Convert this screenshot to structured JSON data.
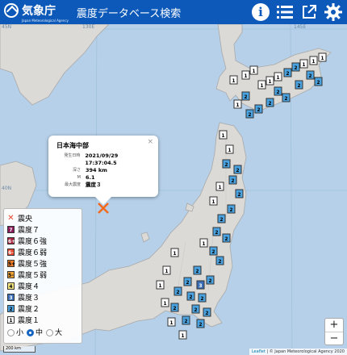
{
  "header": {
    "logo_text": "気象庁",
    "logo_sub": "Japan Meteorological Agency",
    "title": "震度データベース検索"
  },
  "map_labels": {
    "lat_top": "45N",
    "lat_mid": "40N",
    "lon_left": "130E",
    "lon_right": "145E"
  },
  "popup": {
    "title": "日本海中部",
    "close": "×",
    "rows": [
      {
        "label": "発生日時",
        "value": "2021/09/29 17:37:04.5"
      },
      {
        "label": "深さ",
        "value": "394 km"
      },
      {
        "label": "M",
        "value": "6.1"
      },
      {
        "label": "最大震度",
        "value": "震度３"
      }
    ]
  },
  "legend": {
    "epicenter": "震央",
    "items": [
      {
        "num": "7",
        "label": "震度７",
        "color": "#8b1a5a"
      },
      {
        "num": "6+",
        "label": "震度６強",
        "color": "#a3213b"
      },
      {
        "num": "6-",
        "label": "震度６弱",
        "color": "#e5452b"
      },
      {
        "num": "5+",
        "label": "震度５強",
        "color": "#f07d2a"
      },
      {
        "num": "5-",
        "label": "震度５弱",
        "color": "#f7a534"
      },
      {
        "num": "4",
        "label": "震度４",
        "color": "#f6e87e"
      },
      {
        "num": "3",
        "label": "震度３",
        "color": "#3a6fb8"
      },
      {
        "num": "2",
        "label": "震度２",
        "color": "#4aa3e0"
      },
      {
        "num": "1",
        "label": "震度１",
        "color": "#ffffff"
      }
    ],
    "sizes": [
      {
        "label": "小",
        "selected": false
      },
      {
        "label": "中",
        "selected": true
      },
      {
        "label": "大",
        "selected": false
      }
    ]
  },
  "zoom": {
    "in": "+",
    "out": "−"
  },
  "scale": "200 km",
  "attribution": {
    "leaflet": "Leaflet",
    "rest": " | © Japan Meteorological Agency 2020"
  }
}
